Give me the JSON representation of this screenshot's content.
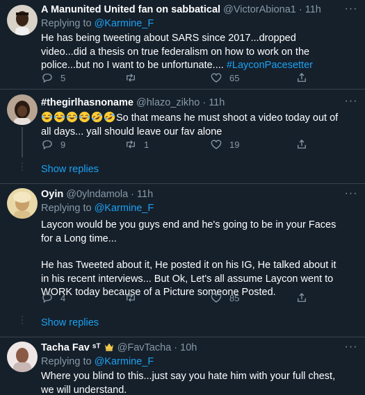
{
  "tweets": [
    {
      "name": "A Manunited United fan on sabbatical",
      "handle": "@VictorAbiona1",
      "time": "11h",
      "reply_prefix": "Replying to ",
      "reply_to": "@Karmine_F",
      "text_main": "He has being tweeting about SARS since 2017...dropped video...did a thesis on true federalism on how to work on the police...but no I want to be unfortunate.... ",
      "hashtag": "#LayconPacesetter",
      "replies": "5",
      "retweets": "",
      "likes": "65"
    },
    {
      "name": "#thegirlhasnoname",
      "handle": "@hlazo_zikho",
      "time": "11h",
      "text": "So that means he must shoot a video today out of all days... yall should leave our fav alone",
      "emojis": [
        "face-with-tears-of-joy",
        "face-with-tears-of-joy",
        "face-with-tears-of-joy",
        "face-with-tears-of-joy",
        "rolling-on-floor-laughing",
        "rolling-on-floor-laughing"
      ],
      "replies": "9",
      "retweets": "1",
      "likes": "19"
    },
    {
      "name": "Oyin",
      "handle": "@0ylndamola",
      "time": "11h",
      "reply_prefix": "Replying to ",
      "reply_to": "@Karmine_F",
      "text_p1": "Laycon would be you guys end and he's going to be in your Faces for a Long time...",
      "text_p2": "He has Tweeted about it, He posted it on his IG, He talked about it in his recent interviews... But Ok, Let's all assume Laycon went to WORK today because of a Picture someone Posted.",
      "replies": "4",
      "retweets": "",
      "likes": "85"
    },
    {
      "name": "Tacha Fav ˢᵀ",
      "handle": "@FavTacha",
      "time": "10h",
      "reply_prefix": "Replying to ",
      "reply_to": "@Karmine_F",
      "text": "Where you blind to this...just say you hate him with your full chest, we will understand."
    }
  ],
  "show_replies_label": "Show replies",
  "separator": " · ",
  "colors": {
    "background": "#15202b",
    "secondary_text": "#8899a6",
    "link": "#1da1f2",
    "border": "#38444d"
  }
}
